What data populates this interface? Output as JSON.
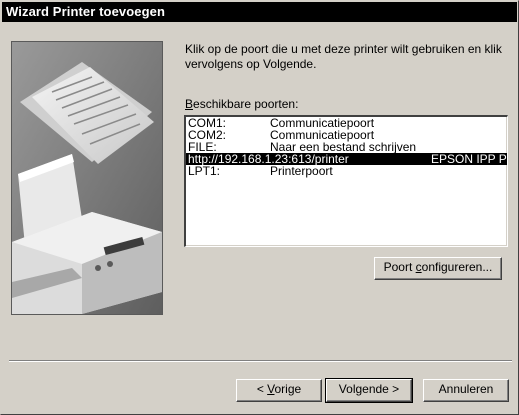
{
  "window": {
    "title": "Wizard Printer toevoegen"
  },
  "instructions": "Klik op de poort die u met deze printer wilt gebruiken en klik vervolgens op Volgende.",
  "ports_label": {
    "mnemonic": "B",
    "rest": "eschikbare poorten:"
  },
  "ports": [
    {
      "port": "COM1:",
      "description": "Communicatiepoort",
      "printer": ""
    },
    {
      "port": "COM2:",
      "description": "Communicatiepoort",
      "printer": ""
    },
    {
      "port": "FILE:",
      "description": "Naar een bestand schrijven",
      "printer": ""
    },
    {
      "port": "http://192.168.1.23:613/printer",
      "description": "",
      "printer": "EPSON IPP P"
    },
    {
      "port": "LPT1:",
      "description": "Printerpoort",
      "printer": ""
    }
  ],
  "selected_port_index": 3,
  "configure_button": {
    "before": "Poort ",
    "mnemonic": "c",
    "after": "onfigureren..."
  },
  "buttons": {
    "back": {
      "before": "< ",
      "mnemonic": "V",
      "after": "orige"
    },
    "next": "Volgende >",
    "cancel": "Annuleren"
  },
  "colors": {
    "dialog_face": "#d4d0c8",
    "titlebar": "#000000",
    "selection": "#000000"
  },
  "icons": {
    "illustration": "printer-illustration"
  }
}
